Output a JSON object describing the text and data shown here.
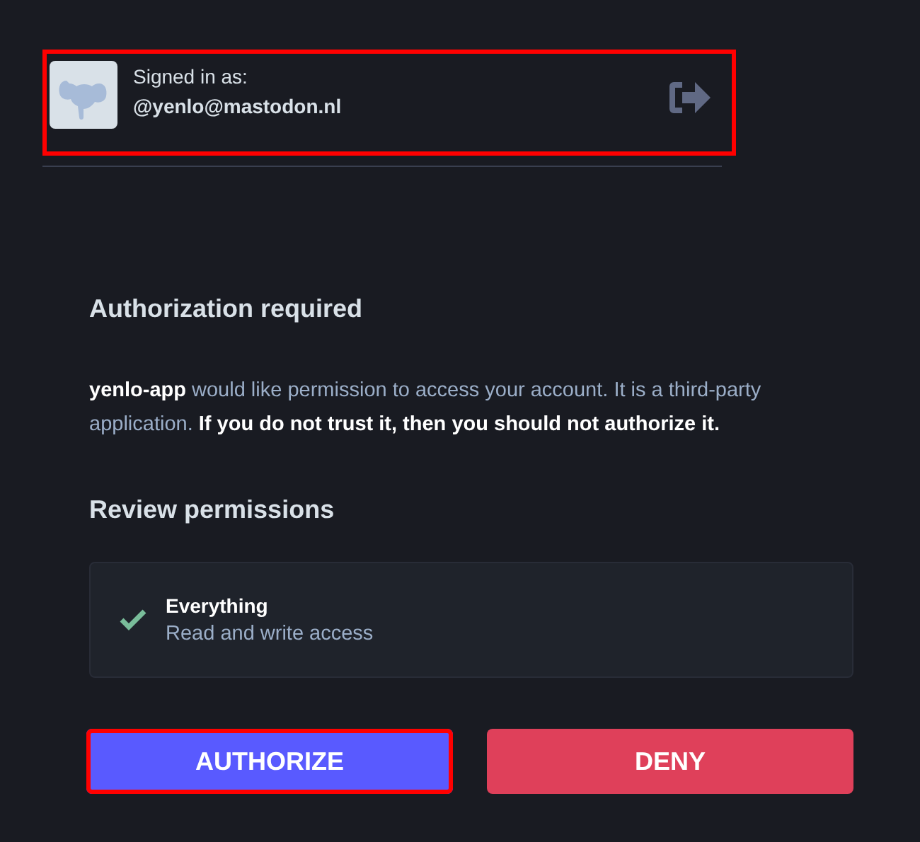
{
  "account": {
    "label": "Signed in as:",
    "handle": "@yenlo@mastodon.nl",
    "highlighted": true
  },
  "heading": "Authorization required",
  "message": "**yenlo-app** would like permission to access your account. It is a third-party application. **If you do not trust it, then you should not authorize it.**",
  "permissions_heading": "Review permissions",
  "permissions": [
    {
      "title": "Everything",
      "description": "Read and write access",
      "checked": true
    }
  ],
  "buttons": [
    {
      "label": "AUTHORIZE",
      "kind": "primary",
      "highlighted": true
    },
    {
      "label": "DENY",
      "kind": "danger",
      "highlighted": false
    }
  ]
}
